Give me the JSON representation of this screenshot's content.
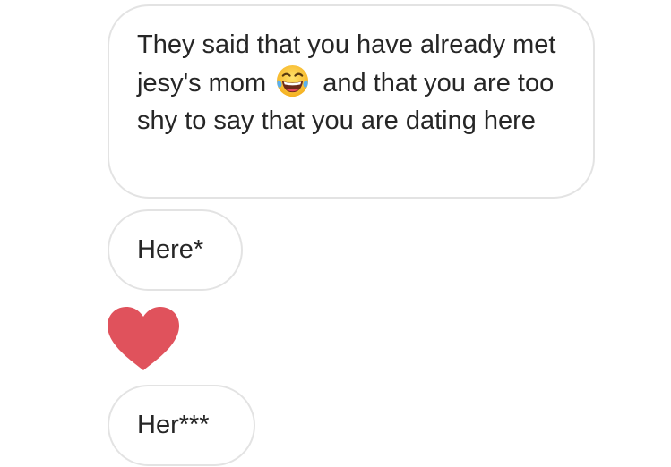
{
  "messages": [
    {
      "type": "text",
      "text_before_emoji": "They said that you have already met jesy's mom",
      "emoji": "face-with-tears-of-joy-icon",
      "text_after_emoji": "and that you are too shy to say that you are dating here"
    },
    {
      "type": "text",
      "text": "Here*"
    },
    {
      "type": "reaction",
      "icon": "heart-icon",
      "color": "#e0525c"
    },
    {
      "type": "text",
      "text": "Her***"
    }
  ],
  "colors": {
    "bubble_border": "#e3e3e3",
    "text": "#262626",
    "heart": "#e0525c",
    "emoji_face": "#fbc02d"
  }
}
